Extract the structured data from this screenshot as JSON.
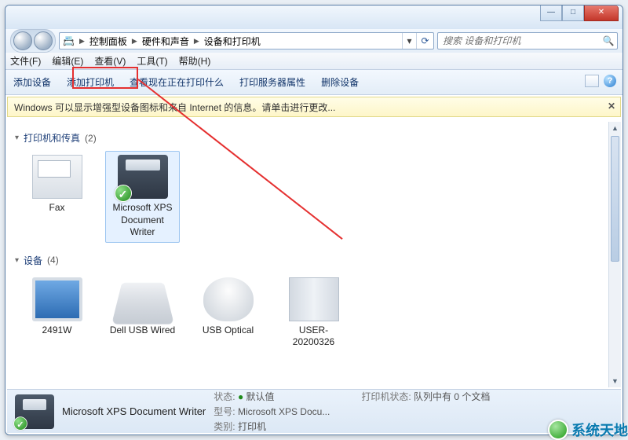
{
  "titlebar": {
    "minimize": "—",
    "maximize": "□",
    "close": "✕"
  },
  "breadcrumb": {
    "icon": "📇",
    "items": [
      "控制面板",
      "硬件和声音",
      "设备和打印机"
    ]
  },
  "nav": {
    "refresh": "⟳",
    "dropdown": "▾"
  },
  "search": {
    "placeholder": "搜索 设备和打印机"
  },
  "menu": {
    "items": [
      "文件(F)",
      "编辑(E)",
      "查看(V)",
      "工具(T)",
      "帮助(H)"
    ]
  },
  "toolbar": {
    "items": [
      "添加设备",
      "添加打印机",
      "查看现在正在打印什么",
      "打印服务器属性",
      "删除设备"
    ],
    "help": "?"
  },
  "infobar": {
    "text": "Windows 可以显示增强型设备图标和来自 Internet 的信息。请单击进行更改...",
    "close": "✕"
  },
  "groups": [
    {
      "title": "打印机和传真",
      "count": "(2)",
      "items": [
        {
          "label": "Fax",
          "kind": "fax"
        },
        {
          "label": "Microsoft XPS Document Writer",
          "kind": "printer",
          "default": true,
          "selected": true
        }
      ]
    },
    {
      "title": "设备",
      "count": "(4)",
      "items": [
        {
          "label": "2491W",
          "kind": "monitor"
        },
        {
          "label": "Dell USB Wired",
          "kind": "keyboard"
        },
        {
          "label": "USB Optical",
          "kind": "mouse"
        },
        {
          "label": "USER-20200326",
          "kind": "tower"
        }
      ]
    }
  ],
  "details": {
    "name": "Microsoft XPS Document Writer",
    "status_label": "状态:",
    "status_value": "默认值",
    "model_label": "型号:",
    "model_value": "Microsoft XPS Docu...",
    "category_label": "类别:",
    "category_value": "打印机",
    "printer_status_label": "打印机状态:",
    "printer_status_value": "队列中有 0 个文档"
  },
  "watermark": {
    "text": "系统天地"
  },
  "colors": {
    "highlight": "#e53030",
    "accent": "#1e3f78"
  }
}
